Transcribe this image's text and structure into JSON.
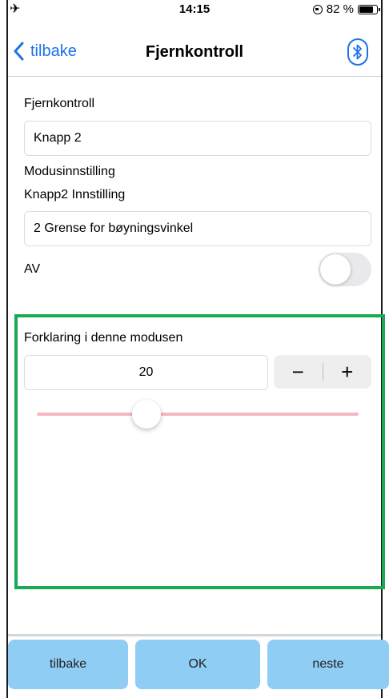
{
  "status_bar": {
    "time": "14:15",
    "battery_text": "82 %",
    "battery_level": 0.82,
    "icons": [
      "airplane-icon",
      "orientation-lock-icon",
      "battery-icon"
    ]
  },
  "nav": {
    "back_label": "tilbake",
    "title": "Fjernkontroll",
    "bluetooth_icon": "bluetooth-icon"
  },
  "form": {
    "remote_label": "Fjernkontroll",
    "remote_value": "Knapp 2",
    "mode_label": "Modusinnstilling",
    "button_setting_label": "Knapp2 Innstilling",
    "button_setting_value": "2 Grense for bøyningsvinkel",
    "toggle_label": "AV",
    "toggle_on": false
  },
  "mode_section": {
    "explanation_label": "Forklaring i denne modusen",
    "value": "20",
    "minus_label": "−",
    "plus_label": "+",
    "slider_fraction": 0.34
  },
  "colors": {
    "accent": "#1a73e8",
    "highlight": "#1aaa55",
    "bottom_button": "#8fcdf5",
    "slider_track": "#f5b8c1"
  },
  "bottom_buttons": {
    "back": "tilbake",
    "ok": "OK",
    "next": "neste"
  }
}
